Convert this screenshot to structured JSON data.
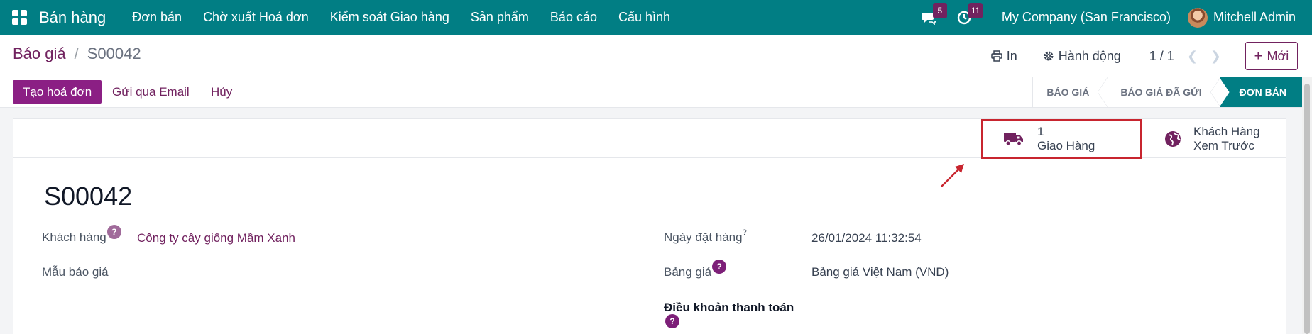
{
  "navbar": {
    "brand": "Bán hàng",
    "menu": [
      "Đơn bán",
      "Chờ xuất Hoá đơn",
      "Kiểm soát Giao hàng",
      "Sản phẩm",
      "Báo cáo",
      "Cấu hình"
    ],
    "messages_count": "5",
    "activities_count": "11",
    "company": "My Company (San Francisco)",
    "user": "Mitchell Admin"
  },
  "control_panel": {
    "breadcrumb_parent": "Báo giá",
    "breadcrumb_separator": "/",
    "breadcrumb_current": "S00042",
    "print_label": "In",
    "action_label": "Hành động",
    "pager": "1 / 1",
    "new_label": "Mới"
  },
  "statusbar": {
    "create_invoice": "Tạo hoá đơn",
    "send_email": "Gửi qua Email",
    "cancel": "Hủy",
    "stages": [
      "BÁO GIÁ",
      "BÁO GIÁ ĐÃ GỬI",
      "ĐƠN BÁN"
    ],
    "active_stage": "ĐƠN BÁN"
  },
  "smart_buttons": {
    "delivery_count": "1",
    "delivery_label": "Giao Hàng",
    "preview_line1": "Khách Hàng",
    "preview_line2": "Xem Trước"
  },
  "form": {
    "title": "S00042",
    "customer_label": "Khách hàng",
    "customer_value": "Công ty cây giống Mầm Xanh",
    "template_label": "Mẫu báo giá",
    "order_date_label": "Ngày đặt hàng",
    "order_date_value": "26/01/2024 11:32:54",
    "pricelist_label": "Bảng giá",
    "pricelist_value": "Bảng giá Việt Nam (VND)",
    "payment_terms_label": "Điều khoản thanh toán",
    "help_mark": "?"
  },
  "colors": {
    "navbar": "#017e84",
    "primary": "#8b1f84",
    "link": "#71225f",
    "highlight": "#c8252f"
  }
}
